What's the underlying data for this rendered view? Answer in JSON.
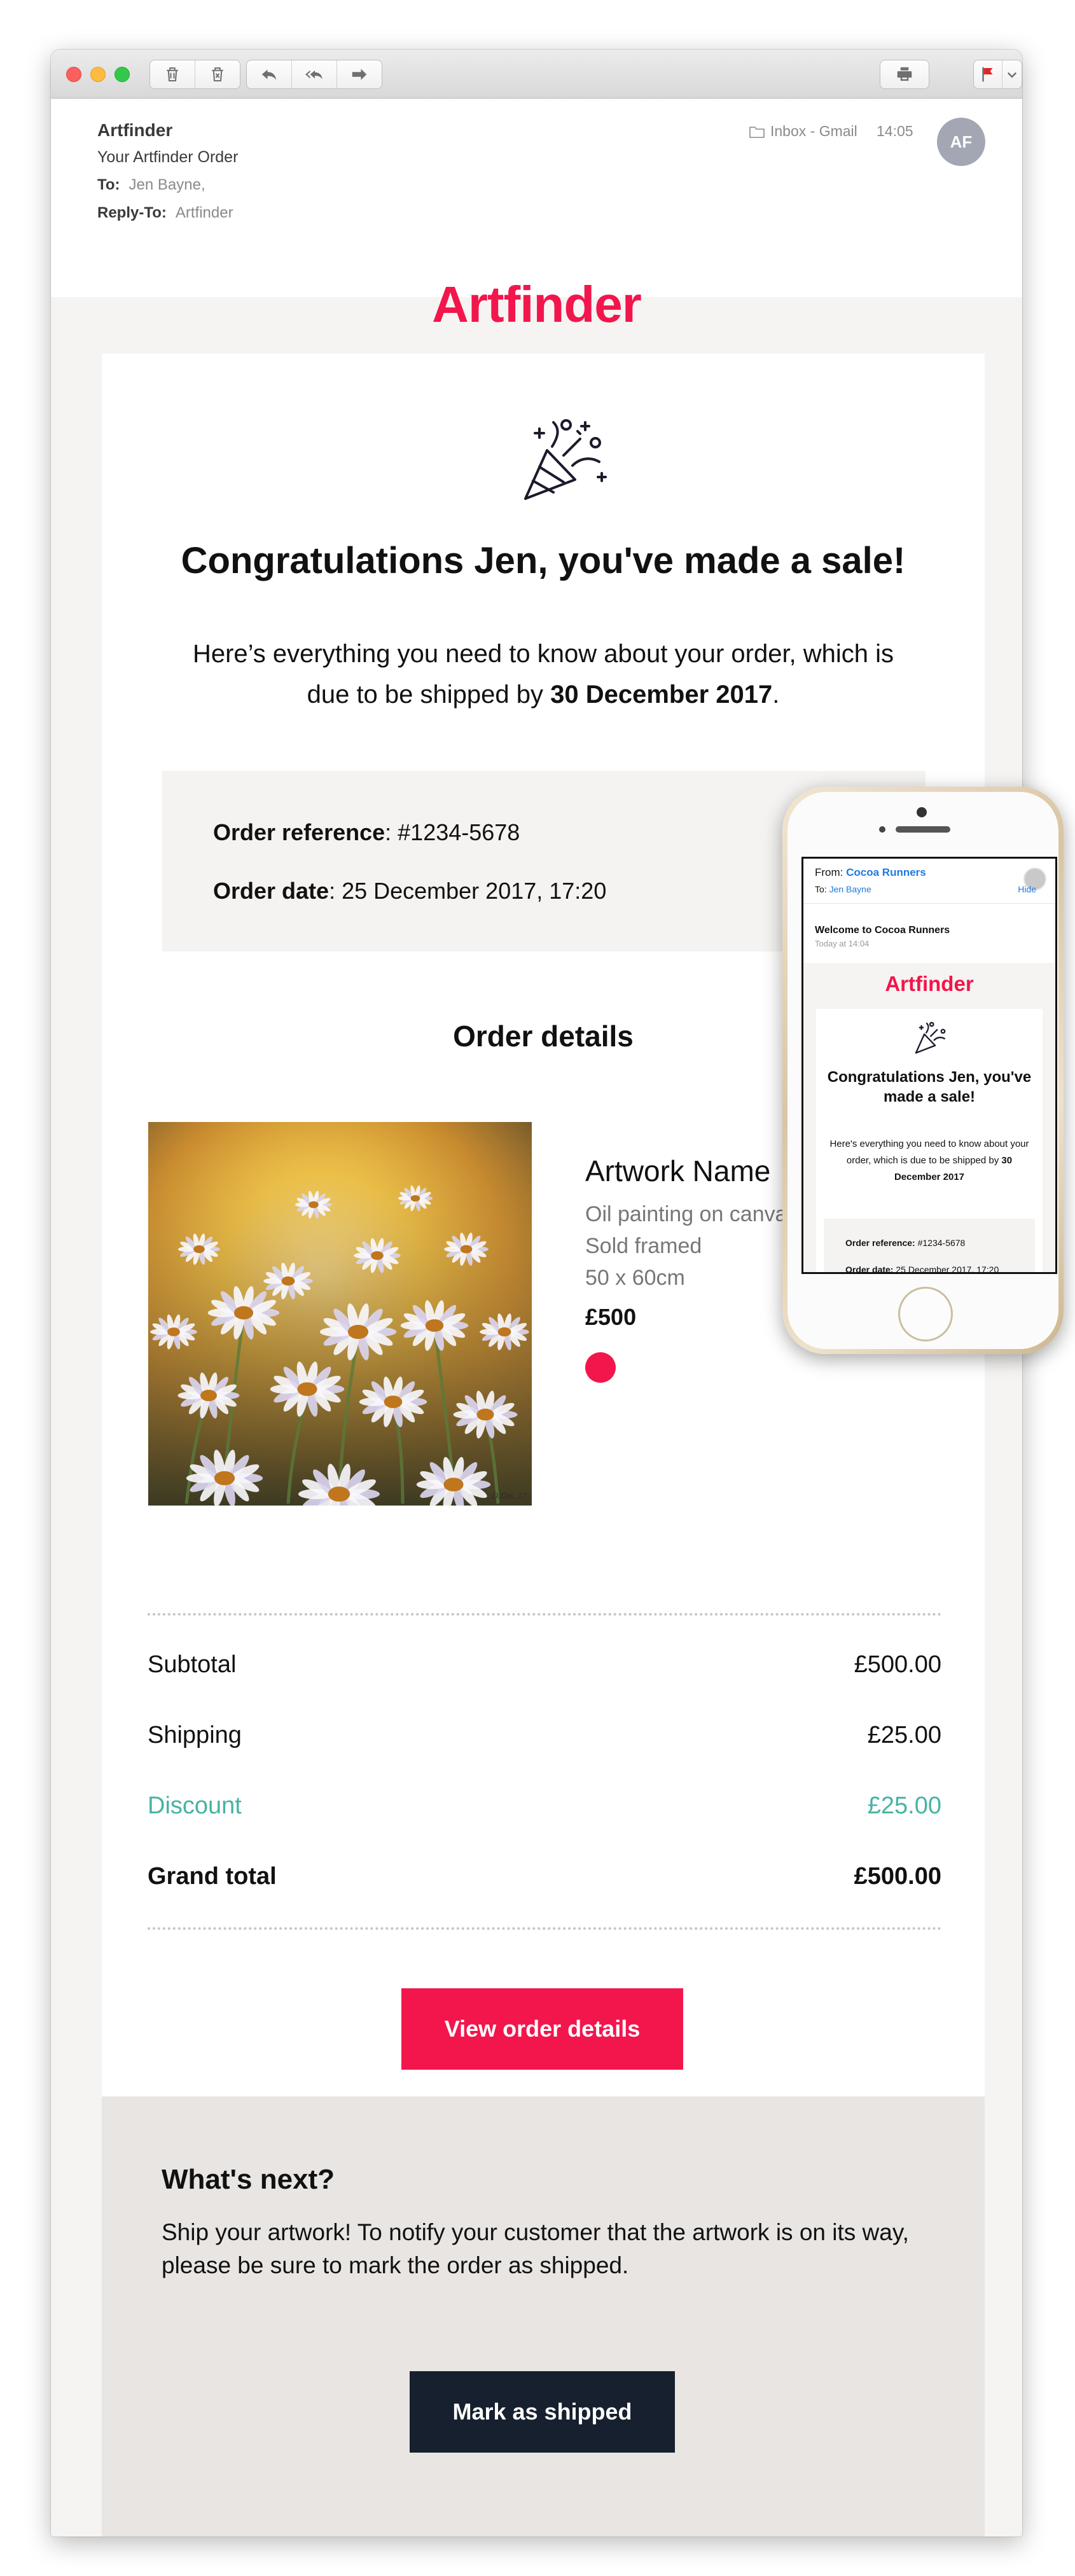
{
  "window": {
    "toolbar": {
      "delete_icon": "trash-icon",
      "junk_icon": "junk-icon",
      "reply_icon": "reply-icon",
      "reply_all_icon": "reply-all-icon",
      "forward_icon": "forward-icon",
      "print_icon": "printer-icon",
      "flag_icon": "flag-icon",
      "flag_color": "#e0262a"
    },
    "header": {
      "from": "Artfinder",
      "subject": "Your Artfinder Order",
      "to_label": "To:",
      "to_value": "Jen Bayne,",
      "reply_label": "Reply-To:",
      "reply_value": "Artfinder",
      "mailbox": "Inbox - Gmail",
      "time": "14:05",
      "avatar_initials": "AF"
    }
  },
  "email": {
    "logo": "Artfinder",
    "brand_color": "#f2164c",
    "headline": "Congratulations Jen, you've made a sale!",
    "intro_prefix": "Here’s everything you need to know about your order, which is due to be shipped by ",
    "intro_date": "30 December 2017",
    "intro_suffix": ".",
    "order_ref_label": "Order reference",
    "order_ref_value": ": #1234-5678",
    "order_date_label": "Order date",
    "order_date_value": ": 25 December 2017, 17:20",
    "order_details_title": "Order details",
    "artwork": {
      "name": "Artwork Name",
      "medium": "Oil painting on canvas",
      "framing": "Sold framed",
      "size": "50 x 60cm",
      "price": "£500"
    },
    "summary": [
      {
        "label": "Subtotal",
        "value": "£500.00"
      },
      {
        "label": "Shipping",
        "value": "£25.00"
      },
      {
        "label": "Discount",
        "value": "£25.00"
      },
      {
        "label": "Grand total",
        "value": "£500.00"
      }
    ],
    "view_button": "View order details",
    "next_title": "What's next?",
    "next_text": "Ship your artwork! To notify your customer that the artwork is on its way, please be sure to mark the order as shipped.",
    "ship_button": "Mark as shipped"
  },
  "phone": {
    "from_label": "From:",
    "from_value": "Cocoa Runners",
    "to_label": "To:",
    "to_value": "Jen Bayne",
    "hide": "Hide",
    "subject": "Welcome to Cocoa Runners",
    "date": "Today at 14:04",
    "logo": "Artfinder",
    "headline": "Congratulations Jen, you've made a sale!",
    "intro_prefix": "Here's everything you need to know about your order, which is due to be shipped by ",
    "intro_date": "30 December 2017",
    "order_ref_label": "Order reference:",
    "order_ref_value": " #1234-5678",
    "order_date_label": "Order date:",
    "order_date_value": " 25 December 2017, 17:20"
  }
}
